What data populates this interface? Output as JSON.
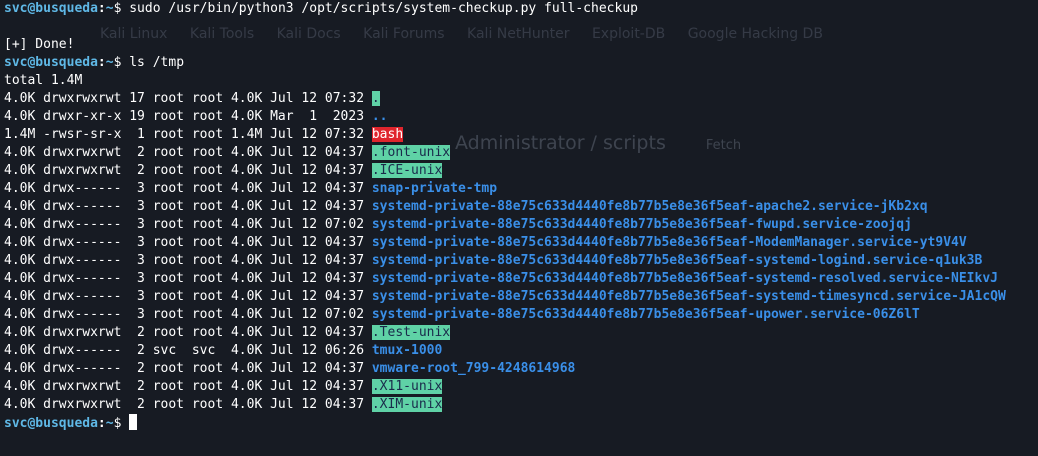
{
  "window": {
    "background": "#171b23",
    "accent_user": "#5fb8e6",
    "accent_dir": "#3a8fe8",
    "sticky_bg": "#5fd2a6",
    "suid_bg": "#e0252d"
  },
  "background_ghost": {
    "bookmarks": [
      "Kali Linux",
      "Kali Tools",
      "Kali Docs",
      "Kali Forums",
      "Kali NetHunter",
      "Exploit-DB",
      "Google Hacking DB"
    ],
    "path_text": "Administrator / scripts",
    "path_sub": "Fetch"
  },
  "prompt": {
    "user_host": "svc@busqueda",
    "separator": ":",
    "path": "~",
    "dollar": "$ "
  },
  "session": [
    {
      "type": "command",
      "text": "sudo /usr/bin/python3 /opt/scripts/system-checkup.py full-checkup"
    },
    {
      "type": "blank"
    },
    {
      "type": "output",
      "text": "[+] Done!"
    },
    {
      "type": "command",
      "text": "ls /tmp"
    },
    {
      "type": "output",
      "text": "total 1.4M"
    }
  ],
  "listing": [
    {
      "prefix": "4.0K drwxrwxrwt 17 root root 4.0K Jul 12 07:32 ",
      "name": ".",
      "style": "sticky"
    },
    {
      "prefix": "4.0K drwxr-xr-x 19 root root 4.0K Mar  1  2023 ",
      "name": "..",
      "style": "dir"
    },
    {
      "prefix": "1.4M -rwsr-sr-x  1 root root 1.4M Jul 12 07:32 ",
      "name": "bash",
      "style": "suid"
    },
    {
      "prefix": "4.0K drwxrwxrwt  2 root root 4.0K Jul 12 04:37 ",
      "name": ".font-unix",
      "style": "sticky"
    },
    {
      "prefix": "4.0K drwxrwxrwt  2 root root 4.0K Jul 12 04:37 ",
      "name": ".ICE-unix",
      "style": "sticky"
    },
    {
      "prefix": "4.0K drwx------  3 root root 4.0K Jul 12 04:37 ",
      "name": "snap-private-tmp",
      "style": "dir"
    },
    {
      "prefix": "4.0K drwx------  3 root root 4.0K Jul 12 04:37 ",
      "name": "systemd-private-88e75c633d4440fe8b77b5e8e36f5eaf-apache2.service-jKb2xq",
      "style": "dir"
    },
    {
      "prefix": "4.0K drwx------  3 root root 4.0K Jul 12 07:02 ",
      "name": "systemd-private-88e75c633d4440fe8b77b5e8e36f5eaf-fwupd.service-zoojqj",
      "style": "dir"
    },
    {
      "prefix": "4.0K drwx------  3 root root 4.0K Jul 12 04:37 ",
      "name": "systemd-private-88e75c633d4440fe8b77b5e8e36f5eaf-ModemManager.service-yt9V4V",
      "style": "dir"
    },
    {
      "prefix": "4.0K drwx------  3 root root 4.0K Jul 12 04:37 ",
      "name": "systemd-private-88e75c633d4440fe8b77b5e8e36f5eaf-systemd-logind.service-q1uk3B",
      "style": "dir"
    },
    {
      "prefix": "4.0K drwx------  3 root root 4.0K Jul 12 04:37 ",
      "name": "systemd-private-88e75c633d4440fe8b77b5e8e36f5eaf-systemd-resolved.service-NEIkvJ",
      "style": "dir"
    },
    {
      "prefix": "4.0K drwx------  3 root root 4.0K Jul 12 04:37 ",
      "name": "systemd-private-88e75c633d4440fe8b77b5e8e36f5eaf-systemd-timesyncd.service-JA1cQW",
      "style": "dir"
    },
    {
      "prefix": "4.0K drwx------  3 root root 4.0K Jul 12 07:02 ",
      "name": "systemd-private-88e75c633d4440fe8b77b5e8e36f5eaf-upower.service-06Z6lT",
      "style": "dir"
    },
    {
      "prefix": "4.0K drwxrwxrwt  2 root root 4.0K Jul 12 04:37 ",
      "name": ".Test-unix",
      "style": "sticky"
    },
    {
      "prefix": "4.0K drwx------  2 svc  svc  4.0K Jul 12 06:26 ",
      "name": "tmux-1000",
      "style": "dir"
    },
    {
      "prefix": "4.0K drwx------  2 root root 4.0K Jul 12 04:37 ",
      "name": "vmware-root_799-4248614968",
      "style": "dir"
    },
    {
      "prefix": "4.0K drwxrwxrwt  2 root root 4.0K Jul 12 04:37 ",
      "name": ".X11-unix",
      "style": "sticky"
    },
    {
      "prefix": "4.0K drwxrwxrwt  2 root root 4.0K Jul 12 04:37 ",
      "name": ".XIM-unix",
      "style": "sticky"
    }
  ]
}
